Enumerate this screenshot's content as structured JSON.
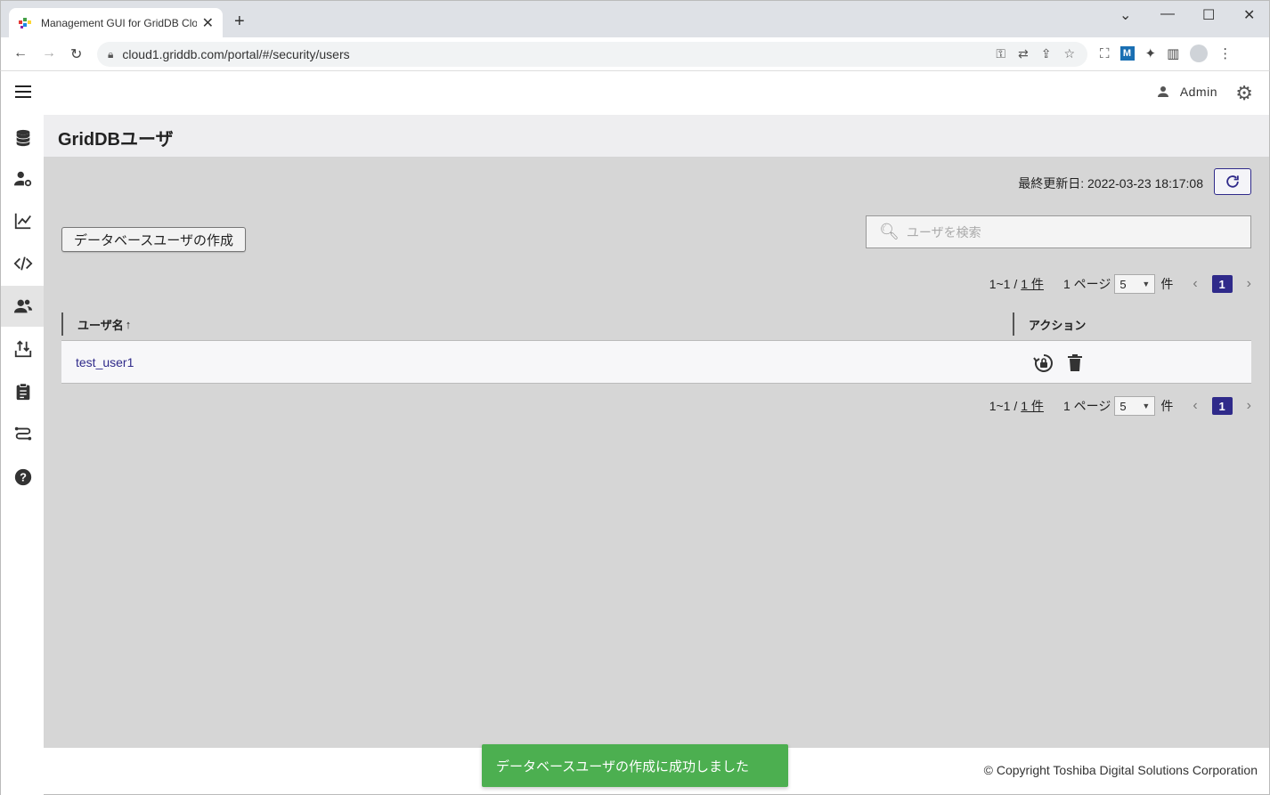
{
  "browser": {
    "tab_title": "Management GUI for GridDB Clo",
    "url": "cloud1.griddb.com/portal/#/security/users"
  },
  "header": {
    "user_name": "Admin"
  },
  "page": {
    "title": "GridDBユーザ",
    "last_updated": "最終更新日: 2022-03-23 18:17:08",
    "create_button": "データベースユーザの作成",
    "search_placeholder": "ユーザを検索"
  },
  "pager": {
    "range": "1~1 /",
    "total": "1 件",
    "per_page_label": "1 ページ",
    "per_page_value": "5",
    "unit": "件",
    "current_page": "1"
  },
  "table": {
    "columns": [
      "ユーザ名",
      "アクション"
    ],
    "sort_indicator": "↑",
    "rows": [
      {
        "user": "test_user1"
      }
    ]
  },
  "toast": {
    "message": "データベースユーザの作成に成功しました"
  },
  "footer": {
    "copyright": "© Copyright Toshiba Digital Solutions Corporation"
  },
  "colors": {
    "accent": "#2f2a8a",
    "toast": "#4caf50",
    "content_bg": "#d6d6d6"
  }
}
